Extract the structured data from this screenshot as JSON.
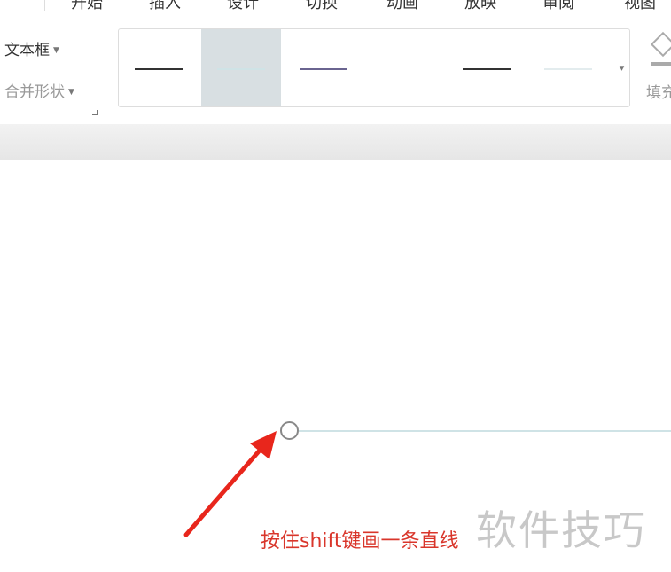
{
  "menu_tabs": [
    "开始",
    "插入",
    "设计",
    "切换",
    "动画",
    "放映",
    "审阅",
    "视图"
  ],
  "ribbon": {
    "textbox_label": "文本框",
    "merge_shapes_label": "合并形状",
    "fill_label": "填充",
    "line_styles": [
      {
        "color": "#333333",
        "selected": false
      },
      {
        "color": "#cfe3e6",
        "selected": true
      },
      {
        "color": "#6a6490",
        "selected": false
      },
      {
        "color": "#ffffff",
        "selected": false
      },
      {
        "color": "#333333",
        "selected": false
      },
      {
        "color": "#e3ecee",
        "selected": false
      }
    ]
  },
  "canvas": {
    "caption": "按住shift键画一条直线",
    "watermark": "软件技巧"
  },
  "colors": {
    "arrow": "#e8261c",
    "caption": "#d9362b",
    "line": "#cfe3e6"
  }
}
